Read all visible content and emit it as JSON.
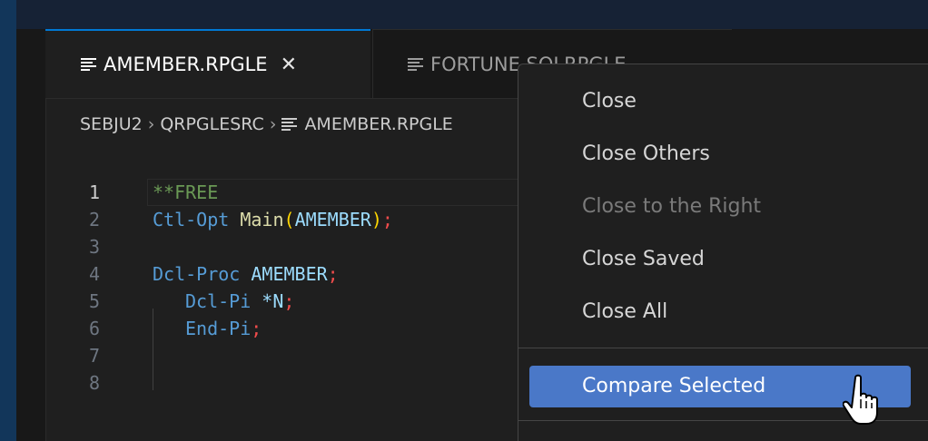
{
  "tabs": [
    {
      "label": "AMEMBER.RPGLE",
      "close": "✕",
      "icon": "lines-file-icon"
    },
    {
      "label": "FORTUNE.SQLRPGLE",
      "icon": "lines-file-icon"
    }
  ],
  "breadcrumb": {
    "items": [
      "SEBJU2",
      "QRPGLESRC",
      "AMEMBER.RPGLE"
    ],
    "separator": "›"
  },
  "editor": {
    "lines": [
      {
        "num": "1",
        "current": true
      },
      {
        "num": "2"
      },
      {
        "num": "3"
      },
      {
        "num": "4"
      },
      {
        "num": "5"
      },
      {
        "num": "6"
      },
      {
        "num": "7"
      },
      {
        "num": "8"
      }
    ],
    "code": {
      "l1": "**FREE",
      "l2_kw": "Ctl-Opt",
      "l2_fn": "Main",
      "l2_open": "(",
      "l2_arg": "AMEMBER",
      "l2_close": ")",
      "l2_semi": ";",
      "l4_kw": "Dcl-Proc",
      "l4_id": "AMEMBER",
      "l4_semi": ";",
      "l5_kw": "Dcl-Pi",
      "l5_id": "*N",
      "l5_semi": ";",
      "l6_kw": "End-Pi",
      "l6_semi": ";"
    }
  },
  "context_menu": {
    "items": [
      {
        "label": "Close",
        "enabled": true
      },
      {
        "label": "Close Others",
        "enabled": true
      },
      {
        "label": "Close to the Right",
        "enabled": false
      },
      {
        "label": "Close Saved",
        "enabled": true
      },
      {
        "label": "Close All",
        "enabled": true
      },
      {
        "label": "Compare Selected",
        "enabled": true,
        "highlighted": true
      }
    ]
  },
  "colors": {
    "accent": "#0078d4",
    "menu_highlight": "#4a78c8"
  }
}
